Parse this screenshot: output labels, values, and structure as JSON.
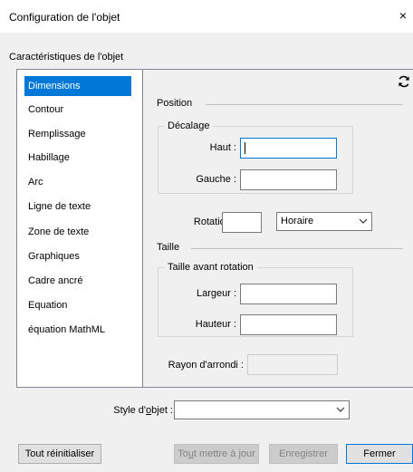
{
  "window": {
    "title": "Configuration de l'objet",
    "close_glyph": "×"
  },
  "section": {
    "label": "Caractéristiques de l'objet"
  },
  "sidebar": {
    "items": [
      {
        "label": "Dimensions",
        "selected": true
      },
      {
        "label": "Contour"
      },
      {
        "label": "Remplissage"
      },
      {
        "label": "Habillage"
      },
      {
        "label": "Arc"
      },
      {
        "label": "Ligne de texte"
      },
      {
        "label": "Zone de texte"
      },
      {
        "label": "Graphiques"
      },
      {
        "label": "Cadre ancré"
      },
      {
        "label": "Equation"
      },
      {
        "label": "équation MathML"
      }
    ]
  },
  "panel": {
    "refresh_icon": "refresh-icon",
    "position": {
      "title": "Position",
      "offset": {
        "title": "Décalage",
        "top_label": "Haut :",
        "top_value": "",
        "left_label": "Gauche :",
        "left_value": ""
      },
      "rotation_label": "Rotation :",
      "rotation_value": "",
      "direction_value": "Horaire"
    },
    "size": {
      "title": "Taille",
      "before_rotation": {
        "title": "Taille avant rotation",
        "width_label": "Largeur :",
        "width_value": "",
        "height_label": "Hauteur :",
        "height_value": ""
      }
    },
    "radius_label": "Rayon d'arrondi :",
    "radius_value": ""
  },
  "object_style": {
    "label_pre": "Style d'",
    "label_ul": "o",
    "label_post": "bjet :",
    "value": ""
  },
  "footer": {
    "reset": "Tout réinitialiser",
    "update_pre": "To",
    "update_ul": "u",
    "update_post": "t mettre à jour",
    "save": "Enregistrer",
    "close": "Fermer"
  }
}
